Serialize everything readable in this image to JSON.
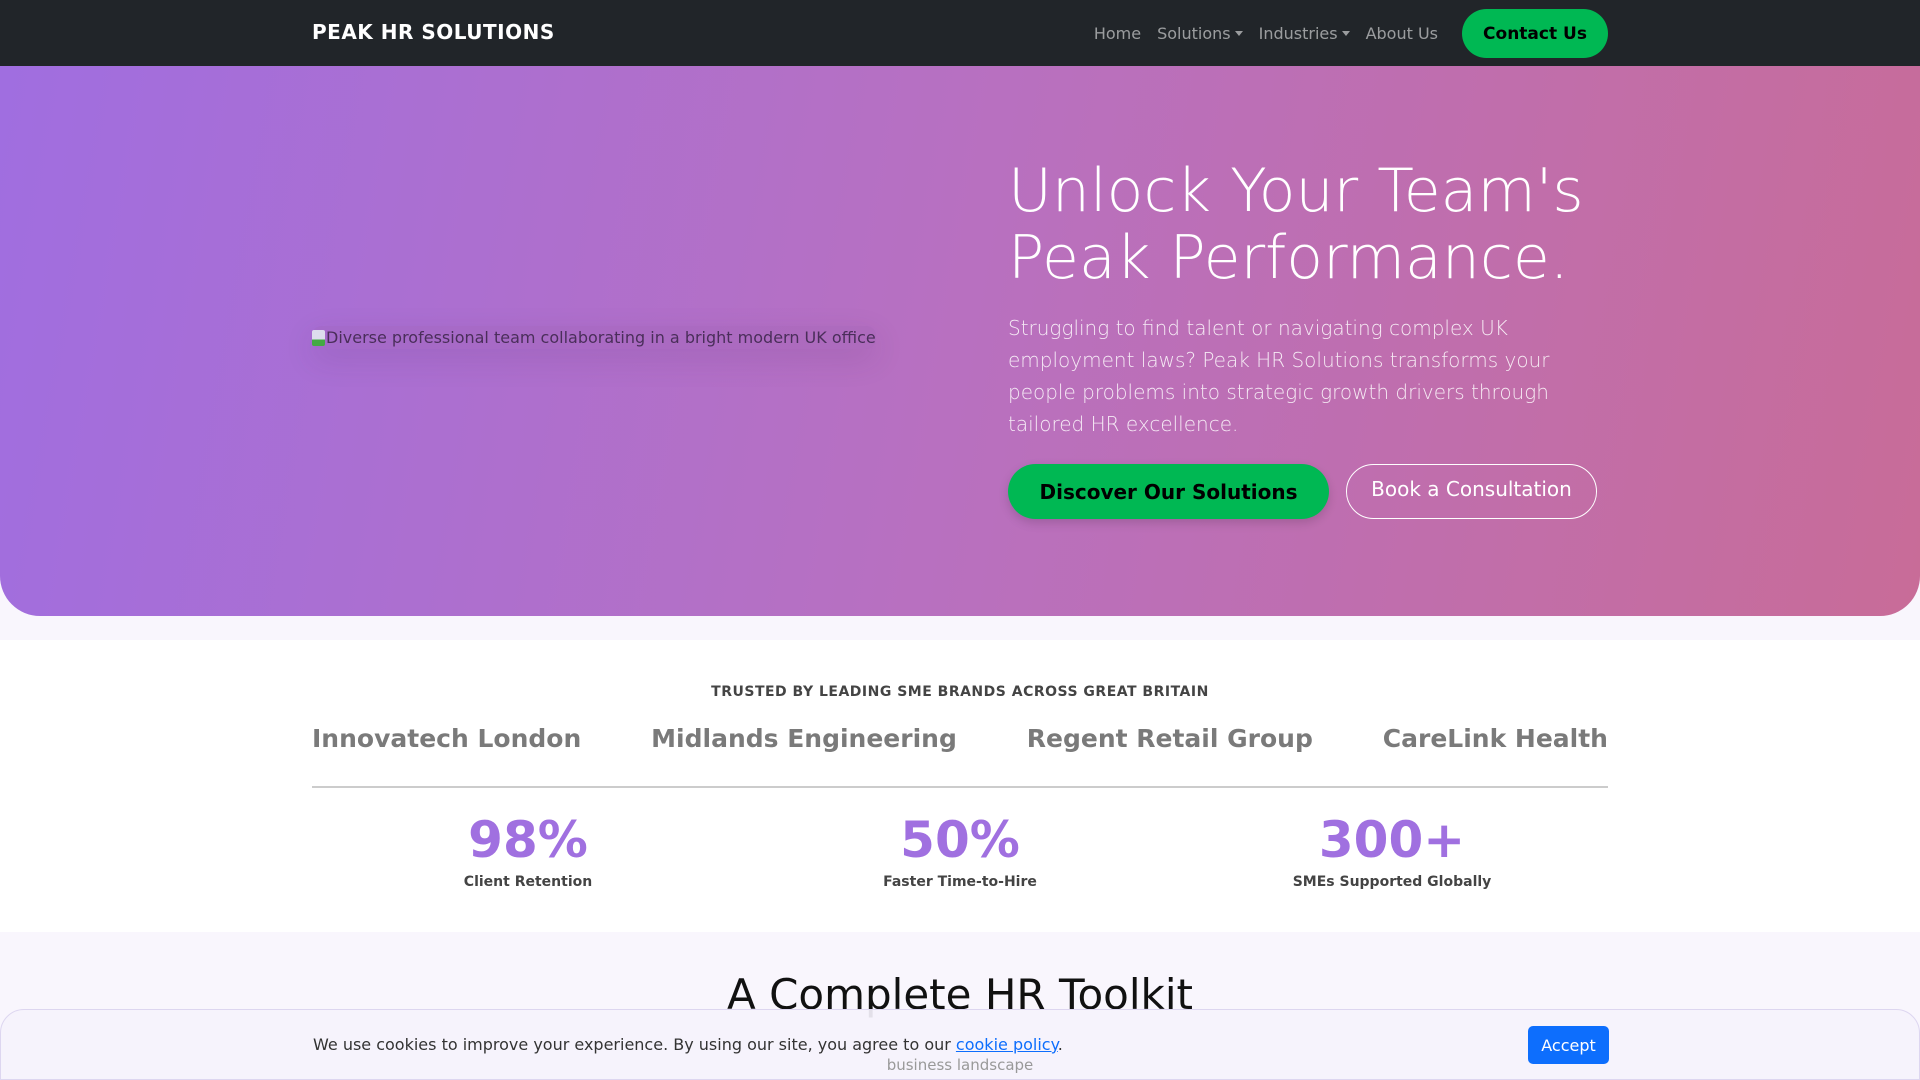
{
  "nav": {
    "brand": "PEAK HR SOLUTIONS",
    "links": [
      "Home",
      "Solutions",
      "Industries",
      "About Us"
    ],
    "contact": "Contact Us"
  },
  "hero": {
    "image_alt": "Diverse professional team collaborating in a bright modern UK office",
    "title": "Unlock Your Team's Peak Performance.",
    "lead": "Struggling to find talent or navigating complex UK employment laws? Peak HR Solutions transforms your people problems into strategic growth drivers through tailored HR excellence.",
    "primary_cta": "Discover Our Solutions",
    "secondary_cta": "Book a Consultation"
  },
  "trust": {
    "label": "TRUSTED BY LEADING SME BRANDS ACROSS GREAT BRITAIN",
    "logos": [
      "Innovatech London",
      "Midlands Engineering",
      "Regent Retail Group",
      "CareLink Health"
    ],
    "stats": [
      {
        "value": "98%",
        "label": "Client Retention"
      },
      {
        "value": "50%",
        "label": "Faster Time-to-Hire"
      },
      {
        "value": "300+",
        "label": "SMEs Supported Globally"
      }
    ]
  },
  "toolkit": {
    "title": "A Complete HR Toolkit",
    "subtitle_fragment": "business landscape"
  },
  "cookie": {
    "text": "We use cookies to improve your experience. By using our site, you agree to our ",
    "link": "cookie policy",
    "end": ".",
    "accept": "Accept"
  },
  "colors": {
    "accent": "#a070e0",
    "cta": "#00b853",
    "accept": "#0d6efd"
  }
}
